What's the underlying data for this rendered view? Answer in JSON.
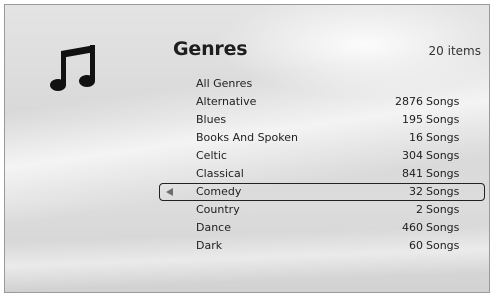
{
  "header": {
    "title": "Genres",
    "item_count": "20 items"
  },
  "icon": "music-note-icon",
  "genres": [
    {
      "name": "All Genres",
      "count": "",
      "unit": ""
    },
    {
      "name": "Alternative",
      "count": "2876",
      "unit": "Songs"
    },
    {
      "name": "Blues",
      "count": "195",
      "unit": "Songs"
    },
    {
      "name": "Books And Spoken",
      "count": "16",
      "unit": "Songs"
    },
    {
      "name": "Celtic",
      "count": "304",
      "unit": "Songs"
    },
    {
      "name": "Classical",
      "count": "841",
      "unit": "Songs"
    },
    {
      "name": "Comedy",
      "count": "32",
      "unit": "Songs",
      "selected": true
    },
    {
      "name": "Country",
      "count": "2",
      "unit": "Songs"
    },
    {
      "name": "Dance",
      "count": "460",
      "unit": "Songs"
    },
    {
      "name": "Dark",
      "count": "60",
      "unit": "Songs"
    }
  ]
}
